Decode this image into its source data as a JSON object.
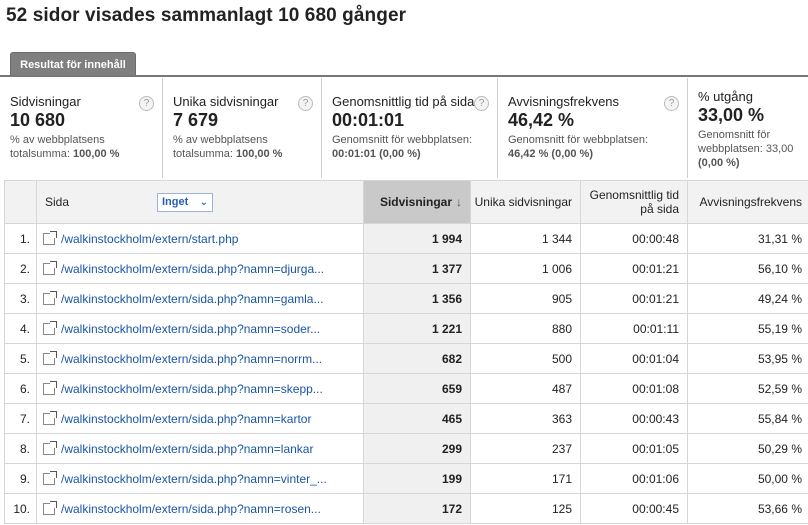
{
  "title": "52 sidor visades sammanlagt 10 680 gånger",
  "tab": "Resultat för innehåll",
  "metrics": [
    {
      "label": "Sidvisningar",
      "value": "10 680",
      "sub1": "% av webbplatsens totalsumma:",
      "sub2": "100,00 %"
    },
    {
      "label": "Unika sidvisningar",
      "value": "7 679",
      "sub1": "% av webbplatsens totalsumma:",
      "sub2": "100,00 %"
    },
    {
      "label": "Genomsnittlig tid på sida",
      "value": "00:01:01",
      "sub1": "Genomsnitt för webbplatsen:",
      "sub2": "00:01:01 (0,00 %)"
    },
    {
      "label": "Avvisningsfrekvens",
      "value": "46,42 %",
      "sub1": "Genomsnitt för webbplatsen:",
      "sub2": "46,42 % (0,00 %)"
    },
    {
      "label": "% utgång",
      "value": "33,00 %",
      "sub1": "Genomsnitt för webbplatsen: 33,00",
      "sub2": "(0,00 %)"
    }
  ],
  "table": {
    "headers": {
      "page": "Sida",
      "dimension": "Inget",
      "pageviews": "Sidvisningar",
      "unique": "Unika sidvisningar",
      "avgtime": "Genomsnittlig tid på sida",
      "bounce": "Avvisningsfrekvens"
    },
    "rows": [
      {
        "idx": "1.",
        "page": "/walkinstockholm/extern/start.php",
        "pageviews": "1 994",
        "unique": "1 344",
        "avgtime": "00:00:48",
        "bounce": "31,31 %"
      },
      {
        "idx": "2.",
        "page": "/walkinstockholm/extern/sida.php?namn=djurga...",
        "pageviews": "1 377",
        "unique": "1 006",
        "avgtime": "00:01:21",
        "bounce": "56,10 %"
      },
      {
        "idx": "3.",
        "page": "/walkinstockholm/extern/sida.php?namn=gamla...",
        "pageviews": "1 356",
        "unique": "905",
        "avgtime": "00:01:21",
        "bounce": "49,24 %"
      },
      {
        "idx": "4.",
        "page": "/walkinstockholm/extern/sida.php?namn=soder...",
        "pageviews": "1 221",
        "unique": "880",
        "avgtime": "00:01:11",
        "bounce": "55,19 %"
      },
      {
        "idx": "5.",
        "page": "/walkinstockholm/extern/sida.php?namn=norrm...",
        "pageviews": "682",
        "unique": "500",
        "avgtime": "00:01:04",
        "bounce": "53,95 %"
      },
      {
        "idx": "6.",
        "page": "/walkinstockholm/extern/sida.php?namn=skepp...",
        "pageviews": "659",
        "unique": "487",
        "avgtime": "00:01:08",
        "bounce": "52,59 %"
      },
      {
        "idx": "7.",
        "page": "/walkinstockholm/extern/sida.php?namn=kartor",
        "pageviews": "465",
        "unique": "363",
        "avgtime": "00:00:43",
        "bounce": "55,84 %"
      },
      {
        "idx": "8.",
        "page": "/walkinstockholm/extern/sida.php?namn=lankar",
        "pageviews": "299",
        "unique": "237",
        "avgtime": "00:01:05",
        "bounce": "50,29 %"
      },
      {
        "idx": "9.",
        "page": "/walkinstockholm/extern/sida.php?namn=vinter_...",
        "pageviews": "199",
        "unique": "171",
        "avgtime": "00:01:06",
        "bounce": "50,00 %"
      },
      {
        "idx": "10.",
        "page": "/walkinstockholm/extern/sida.php?namn=rosen...",
        "pageviews": "172",
        "unique": "125",
        "avgtime": "00:00:45",
        "bounce": "53,66 %"
      }
    ]
  },
  "icons": {
    "help": "help-icon",
    "external": "external-link-icon",
    "sort": "sort-down-arrow-icon",
    "chevron": "chevron-down-icon"
  }
}
